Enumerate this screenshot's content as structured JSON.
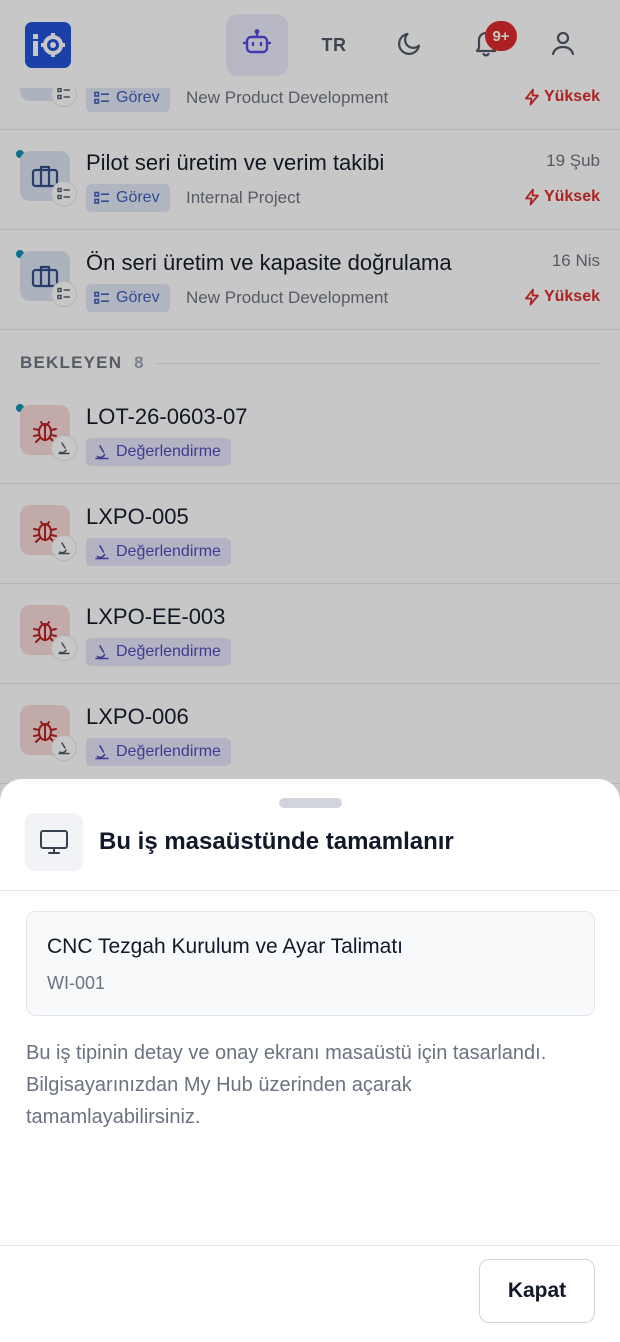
{
  "header": {
    "language": "TR",
    "notification_badge": "9+"
  },
  "list": {
    "rows_top": [
      {
        "title": "",
        "date": "",
        "type": "Görev",
        "project": "New Product Development",
        "priority": "Yüksek"
      },
      {
        "title": "Pilot seri üretim ve verim takibi",
        "date": "19 Şub",
        "type": "Görev",
        "project": "Internal Project",
        "priority": "Yüksek"
      },
      {
        "title": "Ön seri üretim ve kapasite doğrulama",
        "date": "16 Nis",
        "type": "Görev",
        "project": "New Product Development",
        "priority": "Yüksek"
      }
    ],
    "section": {
      "label": "BEKLEYEN",
      "count": "8"
    },
    "rows_pending": [
      {
        "title": "LOT-26-0603-07",
        "type": "Değerlendirme"
      },
      {
        "title": "LXPO-005",
        "type": "Değerlendirme"
      },
      {
        "title": "LXPO-EE-003",
        "type": "Değerlendirme"
      },
      {
        "title": "LXPO-006",
        "type": "Değerlendirme"
      }
    ]
  },
  "sheet": {
    "title": "Bu iş masaüstünde tamamlanır",
    "card": {
      "title": "CNC Tezgah Kurulum ve Ayar Talimatı",
      "code": "WI-001"
    },
    "description": "Bu iş tipinin detay ve onay ekranı masaüstü için tasarlandı. Bilgisayarınızdan My Hub üzerinden açarak tamamlayabilirsiniz.",
    "close_label": "Kapat"
  },
  "icons": {
    "logo": "app-logo-icon",
    "assistant": "robot-icon",
    "theme": "moon-icon",
    "notifications": "bell-icon",
    "profile": "user-icon",
    "task_type": "briefcase-icon",
    "pending_type": "bug-icon",
    "desktop": "monitor-icon"
  },
  "colors": {
    "brand": "#1e50d6",
    "priority_high": "#dc2626",
    "unread_dot": "#0891b2",
    "badge": "#dc2626"
  }
}
